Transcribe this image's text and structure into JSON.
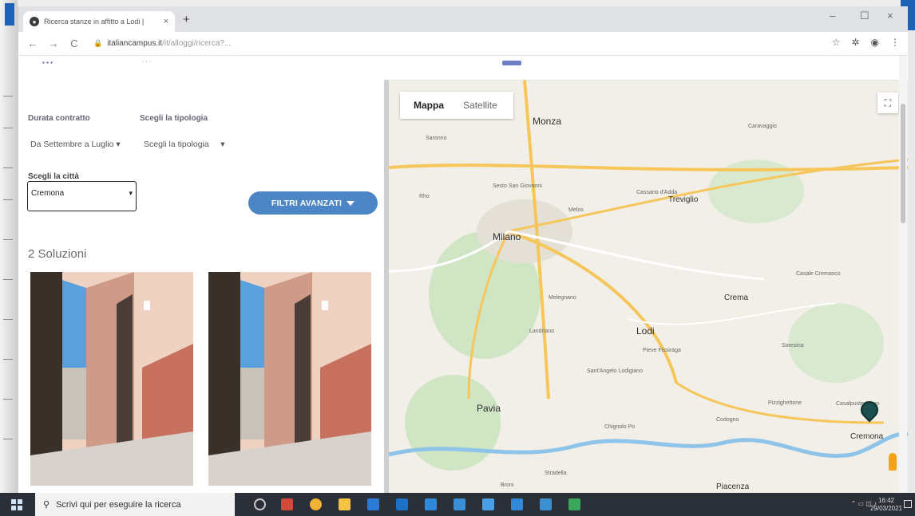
{
  "browser": {
    "tab_title": "Ricerca stanze in affitto a Lodi |",
    "tab_close": "×",
    "new_tab": "+",
    "url_host": "italiancampus.it",
    "url_path": "/it/alloggi/ricerca?...",
    "back": "←",
    "forward": "→",
    "reload": "C",
    "win_min": "–",
    "win_max": "☐",
    "win_close": "×",
    "icons": [
      "star-icon",
      "extensions-icon",
      "profile-icon",
      "menu-icon"
    ]
  },
  "search_form": {
    "contract_label": "Durata contratto",
    "contract_value": "Da Settembre a Luglio",
    "type_label": "Scegli la tipologia",
    "type_value": "Scegli la tipologia",
    "city_label": "Scegli la città",
    "city_value": "Cremona",
    "advanced_filters": "FILTRI AVANZATI"
  },
  "results": {
    "title": "2 Soluzioni"
  },
  "map": {
    "tab_map": "Mappa",
    "tab_satellite": "Satellite",
    "labels": {
      "monza": "Monza",
      "milano": "Milano",
      "lodi": "Lodi",
      "pavia": "Pavia",
      "treviglio": "Treviglio",
      "crema": "Crema",
      "cremona": "Cremona",
      "piacenza": "Piacenza",
      "codogno": "Codogno",
      "chignolo": "Chignolo Po",
      "sesto": "Sesto San Giovanni",
      "cassano": "Cassano d'Adda",
      "melegnano": "Melegnano",
      "cerro": "Sant'Angelo Lodigiano",
      "pieve": "Pieve Fissiraga",
      "soresina": "Soresina",
      "saronno": "Saronno",
      "rho": "Rho",
      "broni": "Broni",
      "stradella": "Stradella",
      "caravaggio": "Caravaggio",
      "melzo": "Melzo",
      "landriano": "Landriano",
      "casalpusterlengo": "Casalpusterlengo",
      "pizzighettone": "Pizzighettone",
      "casale": "Casale Cremasco"
    }
  },
  "taskbar": {
    "search_placeholder": "Scrivi qui per eseguire la ricerca",
    "clock_time": "16:42",
    "clock_date": "29/03/2021"
  },
  "colors": {
    "filter_button": "#4d86c7",
    "map_water": "#8fc4ea",
    "highway": "#f6c65a",
    "pin": "#1b4f4f"
  }
}
